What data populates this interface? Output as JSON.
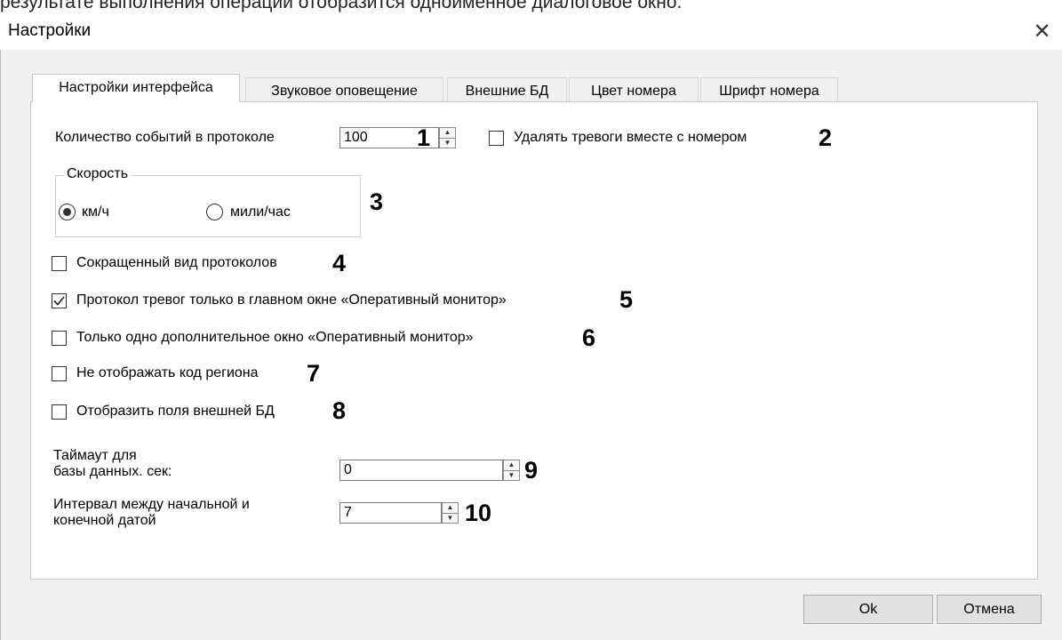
{
  "caption_fragment": "результате выполнения операции отобразится одноименное диалоговое окно.",
  "dialog": {
    "title": "Настройки",
    "close_symbol": "✕"
  },
  "tabs": [
    {
      "label": "Настройки интерфейса",
      "active": true
    },
    {
      "label": "Звуковое оповещение",
      "active": false
    },
    {
      "label": "Внешние БД",
      "active": false
    },
    {
      "label": "Цвет номера",
      "active": false
    },
    {
      "label": "Шрифт номера",
      "active": false
    }
  ],
  "settings": {
    "events_count": {
      "label": "Количество событий в протоколе",
      "value": "100",
      "marker": "1"
    },
    "delete_alarms": {
      "label": "Удалять тревоги вместе с номером",
      "checked": false,
      "marker": "2"
    },
    "speed": {
      "group_title": "Скорость",
      "options": [
        {
          "label": "км/ч",
          "selected": true
        },
        {
          "label": "мили/час",
          "selected": false
        }
      ],
      "marker": "3"
    },
    "short_protocol": {
      "label": "Сокращенный вид протоколов",
      "checked": false,
      "marker": "4"
    },
    "alarm_main_only": {
      "label": "Протокол тревог только в главном окне «Оперативный монитор»",
      "checked": true,
      "marker": "5"
    },
    "single_extra_window": {
      "label": "Только одно дополнительное окно «Оперативный монитор»",
      "checked": false,
      "marker": "6"
    },
    "hide_region": {
      "label": "Не отображать код региона",
      "checked": false,
      "marker": "7"
    },
    "show_ext_db_fields": {
      "label": "Отобразить поля внешней БД",
      "checked": false,
      "marker": "8"
    },
    "db_timeout": {
      "label_line1": "Таймаут для",
      "label_line2": "базы данных. сек:",
      "value": "0",
      "marker": "9"
    },
    "date_interval": {
      "label_line1": "Интервал между начальной и",
      "label_line2": "конечной датой",
      "value": "7",
      "marker": "10"
    }
  },
  "buttons": {
    "ok": "Ok",
    "cancel": "Отмена"
  },
  "icons": {
    "close": "close-icon",
    "check": "check-icon",
    "spin_up": "spin-up-icon",
    "spin_down": "spin-down-icon"
  }
}
